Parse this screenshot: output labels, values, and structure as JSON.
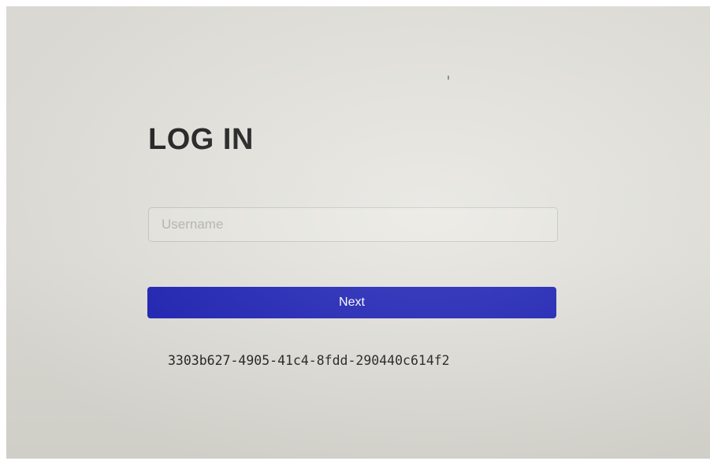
{
  "login": {
    "title": "LOG IN",
    "username_placeholder": "Username",
    "username_value": "",
    "next_label": "Next",
    "session_id": "3303b627-4905-41c4-8fdd-290440c614f2"
  },
  "colors": {
    "button_bg": "#1a1eb5",
    "button_text": "#ffffff",
    "title_text": "#1b1b1b",
    "screen_bg": "#e6e5df"
  }
}
